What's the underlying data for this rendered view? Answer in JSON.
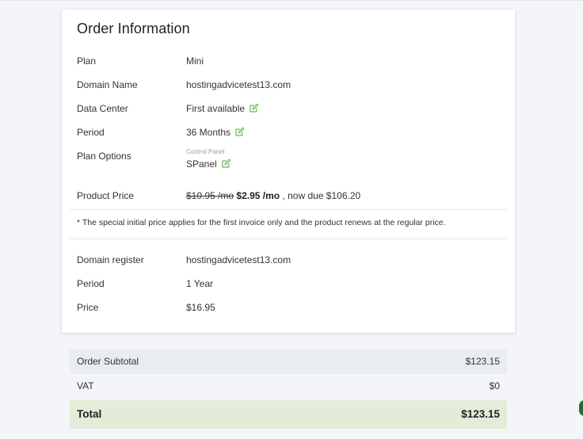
{
  "order": {
    "title": "Order Information",
    "rows": [
      {
        "label": "Plan",
        "value": "Mini"
      },
      {
        "label": "Domain Name",
        "value": "hostingadvicetest13.com"
      },
      {
        "label": "Data Center",
        "value": "First available"
      },
      {
        "label": "Period",
        "value": "36 Months"
      },
      {
        "label": "Plan Options",
        "value": "SPanel",
        "caption": "Control Panel"
      }
    ],
    "product_price": {
      "label": "Product Price",
      "old_price": "$10.95 /mo",
      "new_price": "$2.95 /mo",
      "due_text": ", now due $106.20"
    },
    "note": "* The special initial price applies for the first invoice only and the product renews at the regular price.",
    "domain": [
      {
        "label": "Domain register",
        "value": "hostingadvicetest13.com"
      },
      {
        "label": "Period",
        "value": "1 Year"
      },
      {
        "label": "Price",
        "value": "$16.95"
      }
    ]
  },
  "summary": {
    "subtotal_label": "Order Subtotal",
    "subtotal_value": "$123.15",
    "vat_label": "VAT",
    "vat_value": "$0",
    "total_label": "Total",
    "total_value": "$123.15"
  },
  "colors": {
    "edit_icon": "#5fae48",
    "total_bg": "#e2ecd8",
    "subtotal_bg": "#eaedf0"
  },
  "icons": {
    "edit": "edit-icon"
  }
}
